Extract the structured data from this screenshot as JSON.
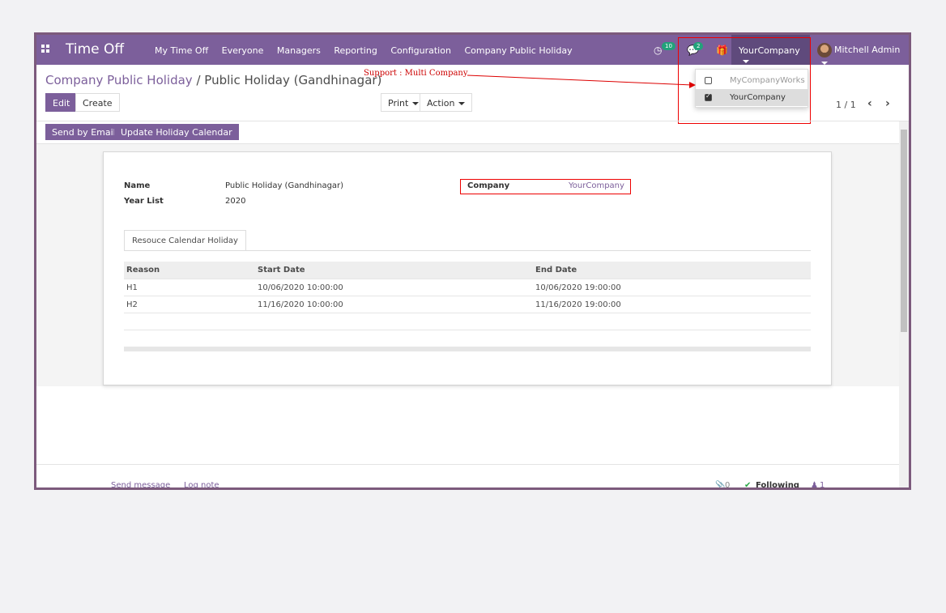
{
  "navbar": {
    "app_title": "Time Off",
    "menu": [
      "My Time Off",
      "Everyone",
      "Managers",
      "Reporting",
      "Configuration",
      "Company Public Holiday"
    ],
    "activity_count": "10",
    "message_count": "2",
    "company": "YourCompany",
    "user": "Mitchell Admin"
  },
  "company_dropdown": {
    "items": [
      {
        "label": "MyCompanyWorks",
        "checked": false
      },
      {
        "label": "YourCompany",
        "checked": true
      }
    ]
  },
  "annotation": "Support : Multi Company",
  "breadcrumb": {
    "parent": "Company Public Holiday",
    "separator": "/",
    "current": "Public Holiday (Gandhinagar)"
  },
  "control": {
    "edit": "Edit",
    "create": "Create",
    "print": "Print",
    "action": "Action",
    "pager": "1 / 1"
  },
  "buttons": {
    "send_email": "Send by Email",
    "update_calendar": "Update Holiday Calendar"
  },
  "form": {
    "name_label": "Name",
    "name_value": "Public Holiday (Gandhinagar)",
    "year_label": "Year List",
    "year_value": "2020",
    "company_label": "Company",
    "company_value": "YourCompany",
    "tab": "Resouce Calendar Holiday",
    "columns": [
      "Reason",
      "Start Date",
      "End Date"
    ],
    "rows": [
      {
        "reason": "H1",
        "start": "10/06/2020 10:00:00",
        "end": "10/06/2020 19:00:00"
      },
      {
        "reason": "H2",
        "start": "11/16/2020 10:00:00",
        "end": "11/16/2020 19:00:00"
      }
    ]
  },
  "chatter": {
    "send_message": "Send message",
    "log_note": "Log note",
    "attachments": "0",
    "following": "Following",
    "followers": "1"
  },
  "colors": {
    "brand": "#7c5f9b",
    "annotation": "#cc0000"
  }
}
